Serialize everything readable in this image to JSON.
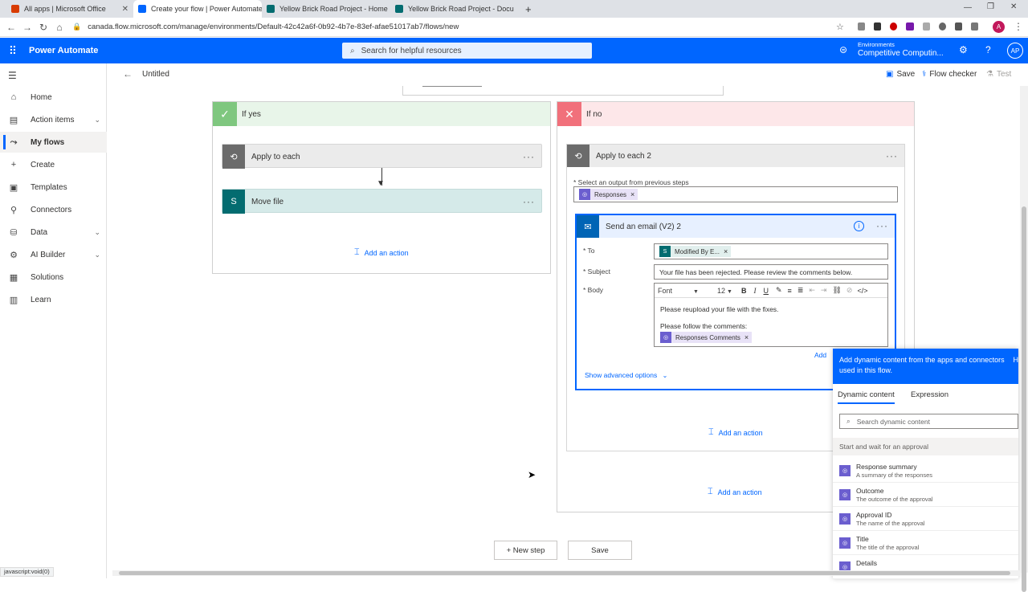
{
  "browser": {
    "tabs": [
      {
        "label": "All apps | Microsoft Office",
        "color": "#d83b01"
      },
      {
        "label": "Create your flow | Power Automate",
        "color": "#0066ff"
      },
      {
        "label": "Yellow Brick Road Project - Home",
        "color": "#036c70"
      },
      {
        "label": "Yellow Brick Road Project - Docu",
        "color": "#036c70"
      }
    ],
    "new_tab": "+",
    "url": "canada.flow.microsoft.com/manage/environments/Default-42c42a6f-0b92-4b7e-83ef-afae51017ab7/flows/new"
  },
  "app": {
    "name": "Power Automate",
    "search_placeholder": "Search for helpful resources",
    "env_label": "Environments",
    "env_value": "Competitive Computin...",
    "avatar": "AP",
    "accent": "#0066ff"
  },
  "sidebar": {
    "items": [
      {
        "label": "Home",
        "icon": "home-icon",
        "glyph": "⌂"
      },
      {
        "label": "Action items",
        "icon": "clipboard-icon",
        "glyph": "▤",
        "expand": true
      },
      {
        "label": "My flows",
        "icon": "flow-icon",
        "glyph": "⤳",
        "active": true
      },
      {
        "label": "Create",
        "icon": "plus-icon",
        "glyph": "+"
      },
      {
        "label": "Templates",
        "icon": "templates-icon",
        "glyph": "▣"
      },
      {
        "label": "Connectors",
        "icon": "connector-icon",
        "glyph": "⚲"
      },
      {
        "label": "Data",
        "icon": "database-icon",
        "glyph": "⛁",
        "expand": true
      },
      {
        "label": "AI Builder",
        "icon": "ai-builder-icon",
        "glyph": "⚙",
        "expand": true
      },
      {
        "label": "Solutions",
        "icon": "solutions-icon",
        "glyph": "▦"
      },
      {
        "label": "Learn",
        "icon": "book-icon",
        "glyph": "▥"
      }
    ]
  },
  "command_bar": {
    "title": "Untitled",
    "save": "Save",
    "flow_checker": "Flow checker",
    "test": "Test"
  },
  "canvas": {
    "if_yes": {
      "label": "If yes",
      "apply_each": "Apply to each",
      "move_file": "Move file",
      "add_action": "Add an action"
    },
    "if_no": {
      "label": "If no",
      "apply_each": "Apply to each 2",
      "select_output_label": "Select an output from previous steps",
      "responses_token": "Responses",
      "email_title": "Send an email (V2) 2",
      "to_label": "To",
      "to_token": "Modified By E...",
      "subject_label": "Subject",
      "subject_value": "Your file has been rejected. Please review the comments below.",
      "body_label": "Body",
      "font": "Font",
      "font_size": "12",
      "body_line1": "Please reupload your file with the fixes.",
      "body_line2": "Please follow the comments:",
      "comments_token": "Responses Comments",
      "add_link": "Add",
      "show_advanced": "Show advanced options",
      "add_action_inner": "Add an action",
      "add_action_outer": "Add an action"
    },
    "new_step": "+ New step",
    "save_button": "Save"
  },
  "dynamic_panel": {
    "header": "Add dynamic content from the apps and connectors used in this flow.",
    "header_right": "H",
    "tab_dynamic": "Dynamic content",
    "tab_expression": "Expression",
    "search_placeholder": "Search dynamic content",
    "section": "Start and wait for an approval",
    "items": [
      {
        "name": "Response summary",
        "desc": "A summary of the responses"
      },
      {
        "name": "Outcome",
        "desc": "The outcome of the approval"
      },
      {
        "name": "Approval ID",
        "desc": "The name of the approval"
      },
      {
        "name": "Title",
        "desc": "The title of the approval"
      },
      {
        "name": "Details",
        "desc": ""
      }
    ]
  },
  "status_bar": "javascript:void(0)"
}
